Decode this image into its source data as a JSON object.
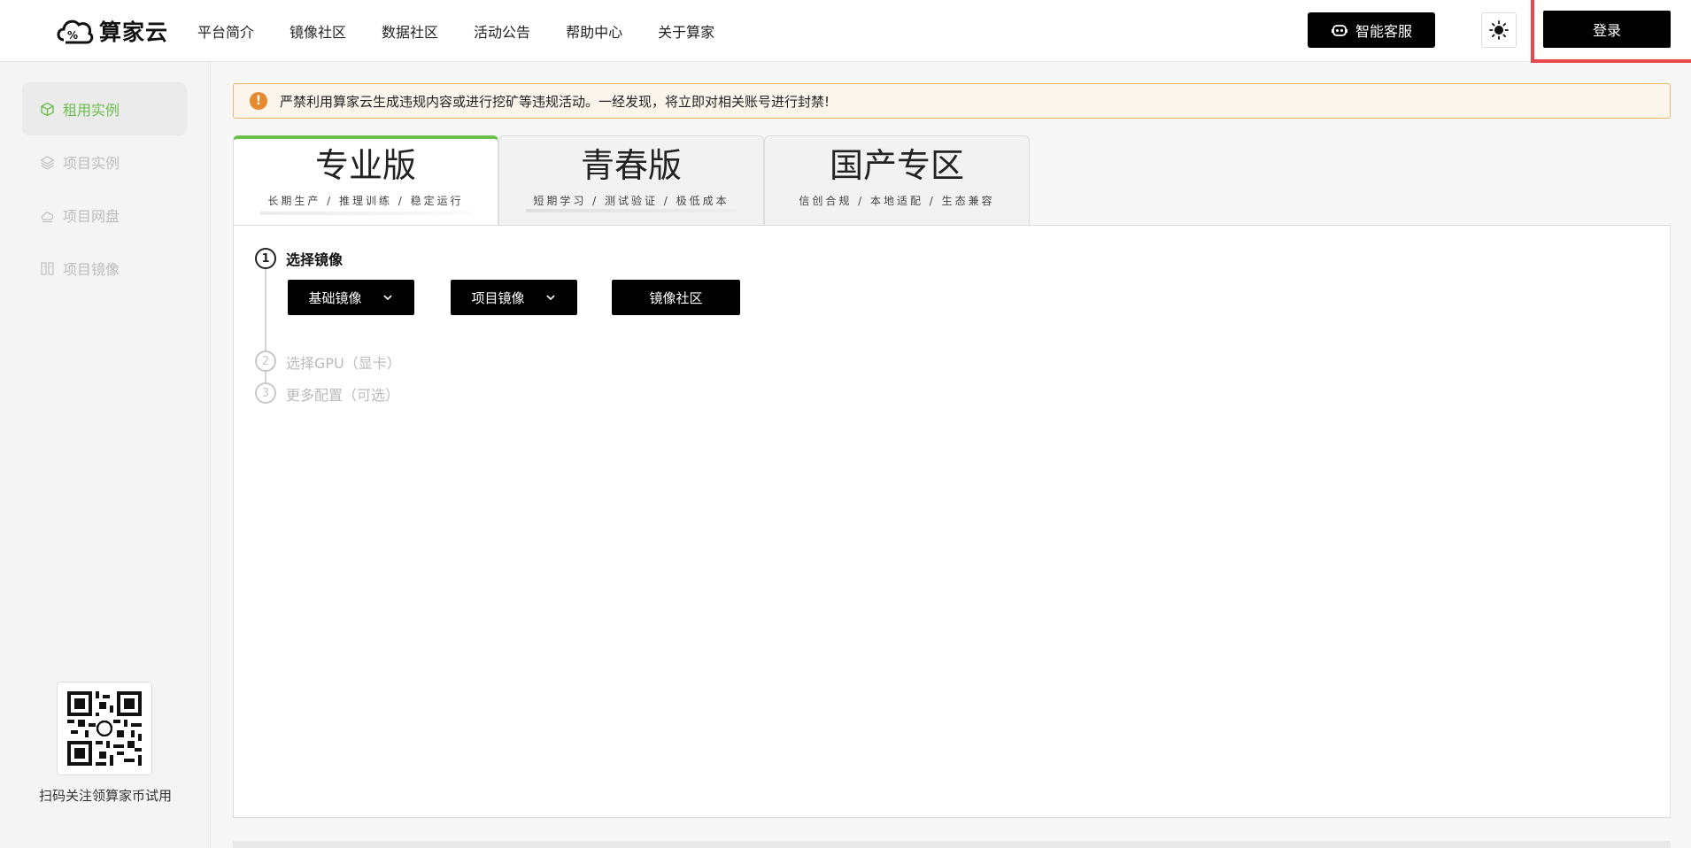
{
  "header": {
    "logo_text": "算家云",
    "nav": [
      "平台简介",
      "镜像社区",
      "数据社区",
      "活动公告",
      "帮助中心",
      "关于算家"
    ],
    "service_label": "智能客服",
    "login_label": "登录",
    "highlight_color": "#e8474c"
  },
  "sidebar": {
    "items": [
      {
        "label": "租用实例",
        "icon": "cube-icon",
        "active": true
      },
      {
        "label": "项目实例",
        "icon": "layers-icon",
        "active": false
      },
      {
        "label": "项目网盘",
        "icon": "cloud-icon",
        "active": false
      },
      {
        "label": "项目镜像",
        "icon": "image-stack-icon",
        "active": false
      }
    ],
    "qr_caption": "扫码关注领算家币试用",
    "accent_color": "#6cbf4b"
  },
  "alert": {
    "icon": "exclamation-icon",
    "text": "严禁利用算家云生成违规内容或进行挖矿等违规活动。一经发现，将立即对相关账号进行封禁!",
    "color": "#e68a2e"
  },
  "tabs": [
    {
      "title": "专业版",
      "subtitle": "长期生产 / 推理训练 / 稳定运行",
      "active": true
    },
    {
      "title": "青春版",
      "subtitle": "短期学习 / 测试验证 / 极低成本",
      "active": false
    },
    {
      "title": "国产专区",
      "subtitle": "信创合规 / 本地适配 / 生态兼容",
      "active": false
    }
  ],
  "steps": [
    {
      "num": "1",
      "label": "选择镜像",
      "active": true
    },
    {
      "num": "2",
      "label": "选择GPU（显卡）",
      "active": false
    },
    {
      "num": "3",
      "label": "更多配置（可选）",
      "active": false
    }
  ],
  "image_buttons": {
    "base": "基础镜像",
    "project": "项目镜像",
    "community": "镜像社区"
  }
}
